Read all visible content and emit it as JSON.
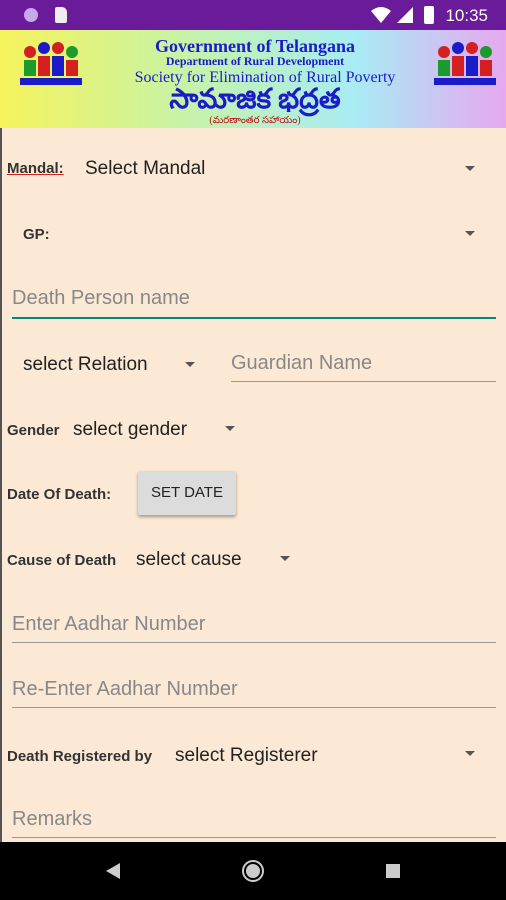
{
  "status_bar": {
    "time": "10:35"
  },
  "banner": {
    "line1": "Government of Telangana",
    "line2": "Department of Rural Development",
    "line3": "Society for Elimination of Rural Poverty",
    "line4": "సామాజిక భద్రత",
    "line5": "(మరణాంతర సహాయం)"
  },
  "form": {
    "mandal_label": "Mandal:",
    "mandal_value": "Select Mandal",
    "gp_label": "GP:",
    "gp_value": "",
    "death_person_placeholder": "Death Person name",
    "relation_value": "select Relation",
    "guardian_placeholder": "Guardian Name",
    "gender_label": "Gender",
    "gender_value": "select gender",
    "date_label": "Date Of Death:",
    "set_date_button": "SET DATE",
    "cause_label": "Cause of Death",
    "cause_value": "select cause",
    "aadhar_placeholder": "Enter Aadhar Number",
    "reaadhar_placeholder": "Re-Enter Aadhar Number",
    "registered_label": "Death Registered by",
    "registered_value": "select Registerer",
    "remarks_placeholder": "Remarks"
  },
  "colors": {
    "accent": "#00897b",
    "status_bar": "#6a1b9a",
    "background": "#fbe9d5"
  }
}
